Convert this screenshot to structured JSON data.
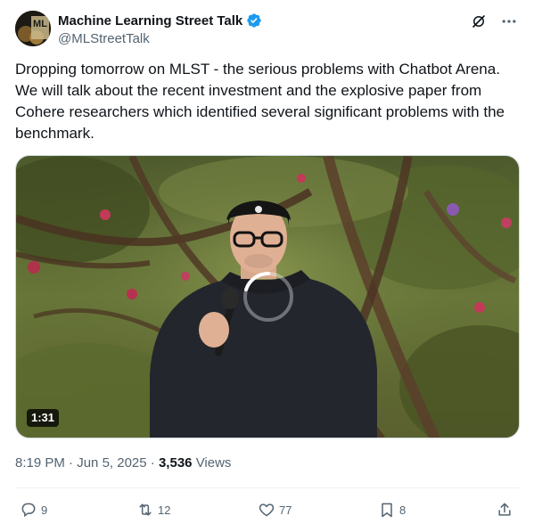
{
  "author": {
    "name": "Machine Learning Street Talk",
    "handle": "@MLStreetTalk",
    "avatar_text_top": "ML",
    "avatar_text_bottom": "STREET TALK"
  },
  "tweet": {
    "text": "Dropping tomorrow on MLST -  the serious problems with Chatbot Arena. We will talk about the recent investment and the explosive paper from Cohere researchers which identified several significant problems with the benchmark."
  },
  "media": {
    "duration": "1:31"
  },
  "meta": {
    "time": "8:19 PM",
    "separator": "·",
    "date": "Jun 5, 2025",
    "views_count": "3,536",
    "views_label": "Views"
  },
  "actions": {
    "replies": "9",
    "retweets": "12",
    "likes": "77",
    "bookmarks": "8"
  },
  "colors": {
    "verified": "#1d9bf0",
    "secondary_text": "#536471",
    "primary_text": "#0f1419"
  }
}
